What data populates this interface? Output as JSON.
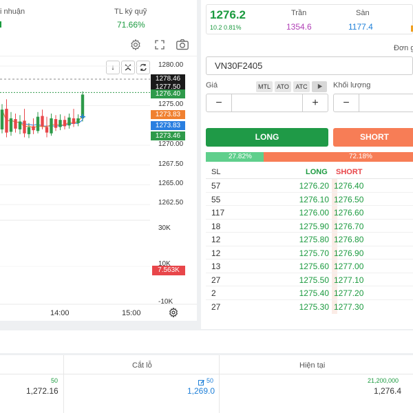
{
  "stats": {
    "profit_label": "i nhuận",
    "fund_ratio_label": "TL ký quỹ",
    "fund_ratio_value": "71.66%"
  },
  "quote": {
    "price": "1276.2",
    "change": "10.2 0.81%",
    "ceiling_label": "Trần",
    "ceiling_value": "1354.6",
    "floor_label": "Sàn",
    "floor_value": "1177.4"
  },
  "order": {
    "unit_label": "Đơn g",
    "symbol": "VN30F2405",
    "price_label": "Giá",
    "qty_label": "Khối lượng",
    "chips": [
      "MTL",
      "ATO",
      "ATC"
    ],
    "minus": "−",
    "plus": "+",
    "long_button": "LONG",
    "short_button": "SHORT",
    "long_ratio": "27.82%",
    "short_ratio": "72.18%",
    "long_fraction": 0.2782,
    "colors": {
      "long": "#1f9a47",
      "short": "#f77d56"
    }
  },
  "orderbook": {
    "headers": {
      "sl": "SL",
      "long": "LONG",
      "short": "SHORT"
    },
    "rows": [
      {
        "sl": "57",
        "long": "1276.20",
        "short": "1276.40"
      },
      {
        "sl": "55",
        "long": "1276.10",
        "short": "1276.50"
      },
      {
        "sl": "117",
        "long": "1276.00",
        "short": "1276.60"
      },
      {
        "sl": "18",
        "long": "1275.90",
        "short": "1276.70"
      },
      {
        "sl": "12",
        "long": "1275.80",
        "short": "1276.80"
      },
      {
        "sl": "12",
        "long": "1275.70",
        "short": "1276.90"
      },
      {
        "sl": "13",
        "long": "1275.60",
        "short": "1277.00"
      },
      {
        "sl": "27",
        "long": "1275.50",
        "short": "1277.10"
      },
      {
        "sl": "2",
        "long": "1275.40",
        "short": "1277.20"
      },
      {
        "sl": "27",
        "long": "1275.30",
        "short": "1277.30"
      }
    ]
  },
  "chart": {
    "price_ticks": [
      "1280.00",
      "1275.00",
      "1270.00",
      "1267.50",
      "1265.00",
      "1262.50"
    ],
    "tags": [
      {
        "text": "1278.46",
        "color": "#1a1a1a"
      },
      {
        "text": "1277.50",
        "color": "#1a1a1a"
      },
      {
        "text": "1276.40",
        "color": "#2e9a4a"
      },
      {
        "text": "1273.83",
        "color": "#f08030"
      },
      {
        "text": "1273.83",
        "color": "#2a7fe0"
      },
      {
        "text": "1273.46",
        "color": "#2e9a4a"
      }
    ],
    "vol_ticks": [
      "30K",
      "10K",
      "-10K"
    ],
    "vol_tag": "7.563K",
    "time_labels": [
      "14:00",
      "15:00"
    ],
    "candles": [
      {
        "o": 1272.0,
        "c": 1274.5,
        "h": 1275.2,
        "l": 1271.5
      },
      {
        "o": 1274.6,
        "c": 1271.6,
        "h": 1275.8,
        "l": 1271.0
      },
      {
        "o": 1271.7,
        "c": 1273.4,
        "h": 1274.2,
        "l": 1271.2
      },
      {
        "o": 1273.3,
        "c": 1272.1,
        "h": 1274.0,
        "l": 1271.6
      },
      {
        "o": 1272.0,
        "c": 1273.0,
        "h": 1273.8,
        "l": 1271.4
      },
      {
        "o": 1273.1,
        "c": 1271.5,
        "h": 1274.6,
        "l": 1271.0
      },
      {
        "o": 1271.4,
        "c": 1272.3,
        "h": 1272.8,
        "l": 1270.9
      },
      {
        "o": 1272.4,
        "c": 1271.9,
        "h": 1273.4,
        "l": 1271.4
      },
      {
        "o": 1271.8,
        "c": 1273.6,
        "h": 1274.2,
        "l": 1271.5
      },
      {
        "o": 1273.7,
        "c": 1272.4,
        "h": 1274.5,
        "l": 1272.0
      },
      {
        "o": 1272.3,
        "c": 1271.6,
        "h": 1273.6,
        "l": 1271.0
      },
      {
        "o": 1271.5,
        "c": 1273.4,
        "h": 1274.0,
        "l": 1271.2
      },
      {
        "o": 1273.3,
        "c": 1272.2,
        "h": 1273.8,
        "l": 1271.8
      },
      {
        "o": 1272.3,
        "c": 1273.2,
        "h": 1273.9,
        "l": 1271.9
      },
      {
        "o": 1273.2,
        "c": 1272.4,
        "h": 1273.7,
        "l": 1272.0
      },
      {
        "o": 1272.5,
        "c": 1273.5,
        "h": 1274.0,
        "l": 1272.1
      },
      {
        "o": 1273.4,
        "c": 1272.7,
        "h": 1274.6,
        "l": 1272.3
      },
      {
        "o": 1272.8,
        "c": 1273.4,
        "h": 1273.9,
        "l": 1272.4
      },
      {
        "o": 1273.4,
        "c": 1276.4,
        "h": 1276.8,
        "l": 1273.0
      }
    ]
  },
  "positions": {
    "stop_loss_label": "Cắt lỗ",
    "current_label": "Hiện tại",
    "col1_qty": "50",
    "col1_value": "1,272.16",
    "stop_qty": "50",
    "stop_value": "1,269.0",
    "current_qty": "21,200,000",
    "current_value": "1,276.4"
  }
}
